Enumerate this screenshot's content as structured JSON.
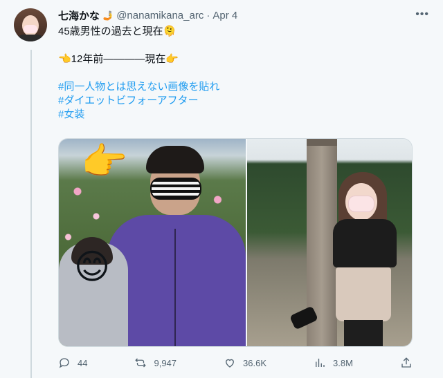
{
  "tweet": {
    "author": {
      "display_name": "七海かな",
      "name_emoji": "🤳",
      "handle": "@nanamikana_arc",
      "separator": "·",
      "date": "Apr 4"
    },
    "text_lines": [
      "45歳男性の過去と現在🫠",
      "👈12年前————現在👉"
    ],
    "hashtags": [
      "#同一人物とは思えない画像を貼れ",
      "#ダイエットビフォーアフター",
      "#女装"
    ],
    "media": {
      "left_overlay_emojis": [
        "👉",
        "😊"
      ],
      "right_photo": "after"
    },
    "actions": {
      "reply_count": "44",
      "retweet_count": "9,947",
      "like_count": "36.6K",
      "view_count": "3.8M"
    },
    "icons": [
      "reply-icon",
      "retweet-icon",
      "like-icon",
      "views-icon",
      "share-icon",
      "more-icon"
    ],
    "colors": {
      "hashtag": "#1d9bf0",
      "secondary_text": "#536471",
      "background": "#f5f8fa"
    }
  }
}
